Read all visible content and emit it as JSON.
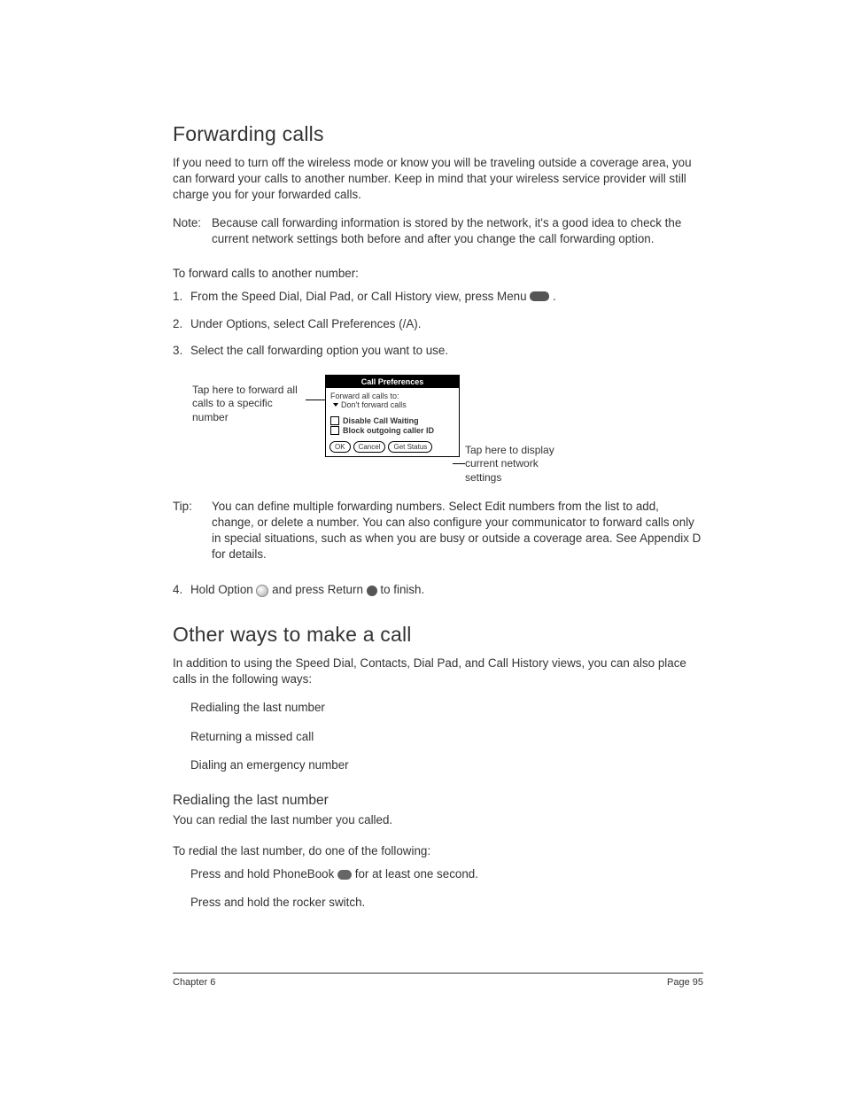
{
  "h1_forwarding": "Forwarding calls",
  "p_forwarding_intro": "If you need to turn off the wireless mode or know you will be traveling outside a coverage area, you can forward your calls to another number. Keep in mind that your wireless service provider will still charge you for your forwarded calls.",
  "note_label": "Note:",
  "note_text": "Because call forwarding information is stored by the network, it's a good idea to check the current network settings both before and after you change the call forwarding option.",
  "sub_to_forward": "To forward calls to another number:",
  "steps": [
    "From the Speed Dial, Dial Pad, or Call History view, press Menu ",
    "Under Options, select Call Preferences (/A).",
    "Select the call forwarding option you want to use."
  ],
  "diagram": {
    "callout_left": "Tap here to forward all calls to a specific number",
    "callout_right": "Tap here to display current network settings",
    "title": "Call Preferences",
    "line1": "Forward all calls to:",
    "line2": "Don't forward calls",
    "chk1": "Disable Call Waiting",
    "chk2": "Block outgoing caller ID",
    "btn_ok": "OK",
    "btn_cancel": "Cancel",
    "btn_status": "Get Status"
  },
  "tip_label": "Tip:",
  "tip_text": "You can define multiple forwarding numbers. Select Edit numbers from the list to add, change, or delete a number. You can also configure your communicator to forward calls only in special situations, such as when you are busy or outside a coverage area. See Appendix D for details.",
  "step4_num": "4.",
  "step4_a": "Hold Option ",
  "step4_b": " and press Return ",
  "step4_c": " to finish.",
  "h1_other": "Other ways to make a call",
  "p_other_intro": "In addition to using the Speed Dial, Contacts, Dial Pad, and Call History views, you can also place calls in the following ways:",
  "other_bullets": [
    "Redialing the last number",
    "Returning a missed call",
    "Dialing an emergency number"
  ],
  "h2_redial": "Redialing the last number",
  "p_redial_intro": "You can redial the last number you called.",
  "sub_to_redial": "To redial the last number, do one of the following:",
  "redial_b1_a": "Press and hold PhoneBook ",
  "redial_b1_b": " for at least one second.",
  "redial_b2": "Press and hold the rocker switch.",
  "footer_left": "Chapter 6",
  "footer_right": "Page 95",
  "chart_data": null
}
